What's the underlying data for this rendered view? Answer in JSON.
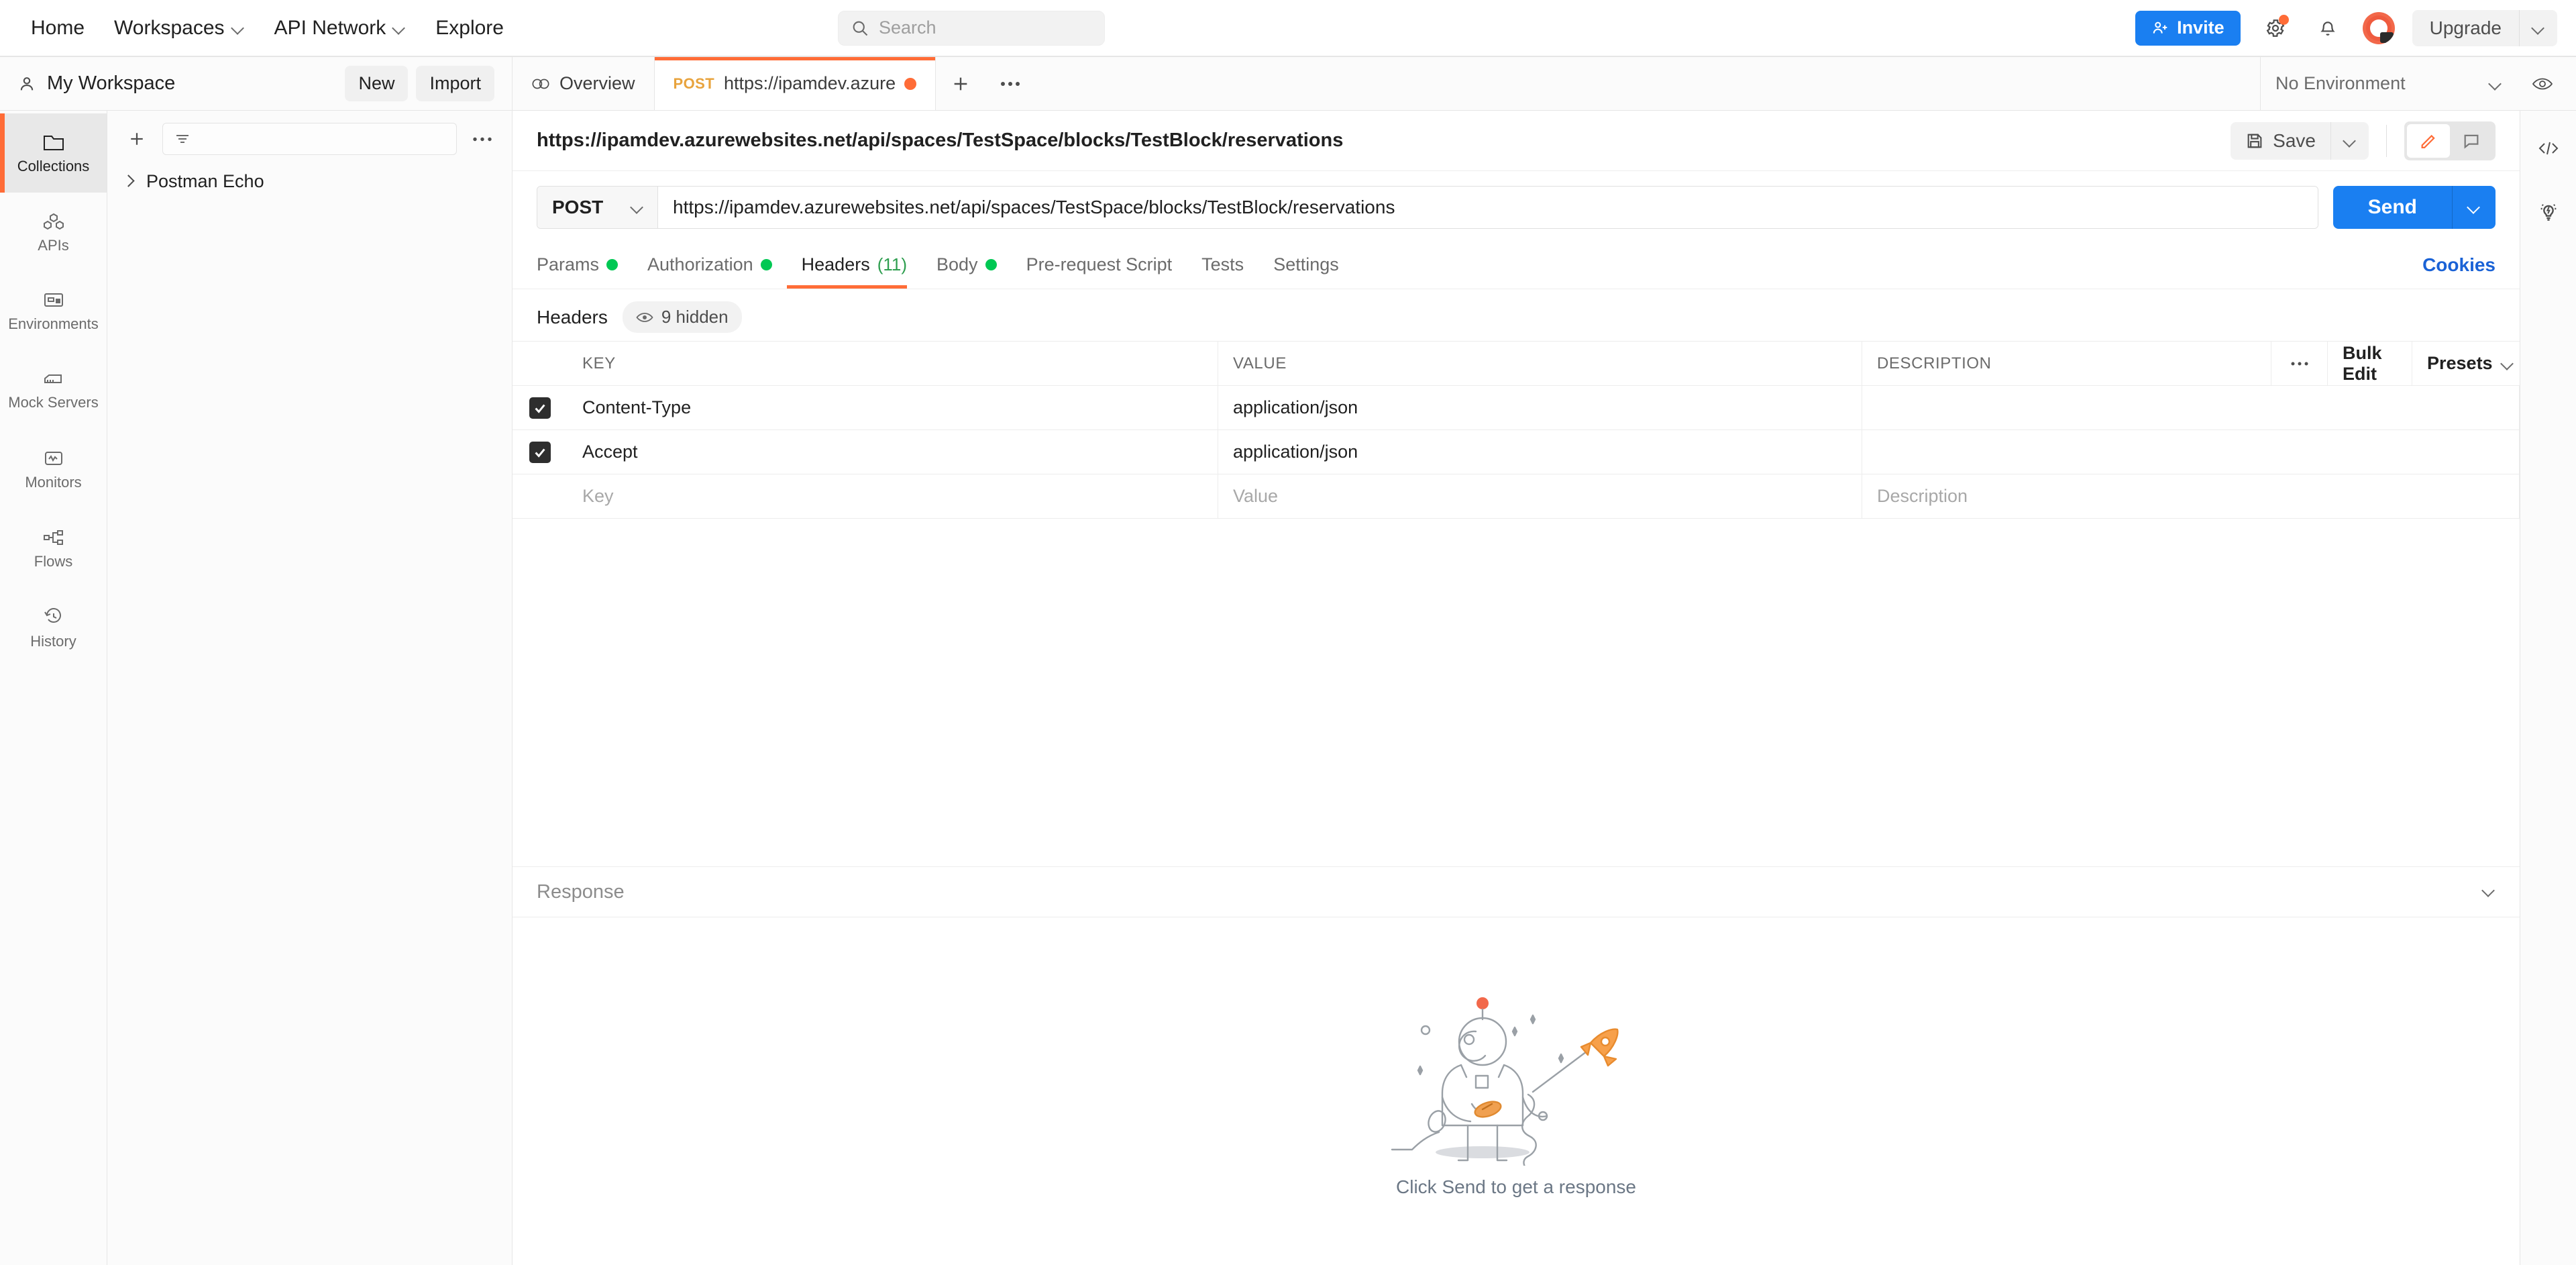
{
  "topnav": {
    "items": [
      {
        "label": "Home",
        "caret": false
      },
      {
        "label": "Workspaces",
        "caret": true
      },
      {
        "label": "API Network",
        "caret": true
      },
      {
        "label": "Explore",
        "caret": false
      }
    ],
    "search": {
      "placeholder": "Search",
      "value": ""
    },
    "invite_label": "Invite",
    "upgrade_label": "Upgrade",
    "icons": [
      "search-icon",
      "settings-gear-icon",
      "notification-bell-icon",
      "user-avatar",
      "chevron-down-icon"
    ],
    "accent_blue": "#1a7ff1",
    "accent_orange": "#ff6c37"
  },
  "workspace": {
    "name": "My Workspace",
    "new_label": "New",
    "import_label": "Import"
  },
  "tabs": {
    "overview_label": "Overview",
    "request_tab": {
      "method": "POST",
      "label": "https://ipamdev.azure",
      "unsaved": true
    },
    "environment": {
      "selected": "No Environment"
    }
  },
  "sidebar": {
    "items": [
      {
        "label": "Collections",
        "icon": "collections-icon",
        "active": true
      },
      {
        "label": "APIs",
        "icon": "apis-icon",
        "active": false
      },
      {
        "label": "Environments",
        "icon": "environments-icon",
        "active": false
      },
      {
        "label": "Mock Servers",
        "icon": "mock-servers-icon",
        "active": false
      },
      {
        "label": "Monitors",
        "icon": "monitors-icon",
        "active": false
      },
      {
        "label": "Flows",
        "icon": "flows-icon",
        "active": false
      },
      {
        "label": "History",
        "icon": "history-icon",
        "active": false
      }
    ]
  },
  "collections": {
    "filter_placeholder": "",
    "items": [
      {
        "label": "Postman Echo",
        "expanded": false
      }
    ]
  },
  "request": {
    "title": "https://ipamdev.azurewebsites.net/api/spaces/TestSpace/blocks/TestBlock/reservations",
    "save_label": "Save",
    "method": "POST",
    "url": "https://ipamdev.azurewebsites.net/api/spaces/TestSpace/blocks/TestBlock/reservations",
    "send_label": "Send",
    "cookies_label": "Cookies",
    "tabs": [
      {
        "label": "Params",
        "dot": true,
        "count": "",
        "active": false
      },
      {
        "label": "Authorization",
        "dot": true,
        "count": "",
        "active": false
      },
      {
        "label": "Headers",
        "dot": false,
        "count": "(11)",
        "active": true
      },
      {
        "label": "Body",
        "dot": true,
        "count": "",
        "active": false
      },
      {
        "label": "Pre-request Script",
        "dot": false,
        "count": "",
        "active": false
      },
      {
        "label": "Tests",
        "dot": false,
        "count": "",
        "active": false
      },
      {
        "label": "Settings",
        "dot": false,
        "count": "",
        "active": false
      }
    ]
  },
  "headers_panel": {
    "section_label": "Headers",
    "hidden_label": "9 hidden",
    "columns": {
      "key": "KEY",
      "value": "VALUE",
      "description": "DESCRIPTION"
    },
    "bulk_edit_label": "Bulk Edit",
    "presets_label": "Presets",
    "rows": [
      {
        "checked": true,
        "key": "Content-Type",
        "value": "application/json",
        "description": ""
      },
      {
        "checked": true,
        "key": "Accept",
        "value": "application/json",
        "description": ""
      }
    ],
    "new_row": {
      "key_placeholder": "Key",
      "value_placeholder": "Value",
      "description_placeholder": "Description"
    }
  },
  "response": {
    "title": "Response",
    "empty_caption": "Click Send to get a response",
    "illustration": "astronaut-rocket-kite"
  },
  "right_rail": {
    "items": [
      {
        "icon": "code-icon"
      },
      {
        "icon": "lightbulb-icon"
      }
    ]
  }
}
